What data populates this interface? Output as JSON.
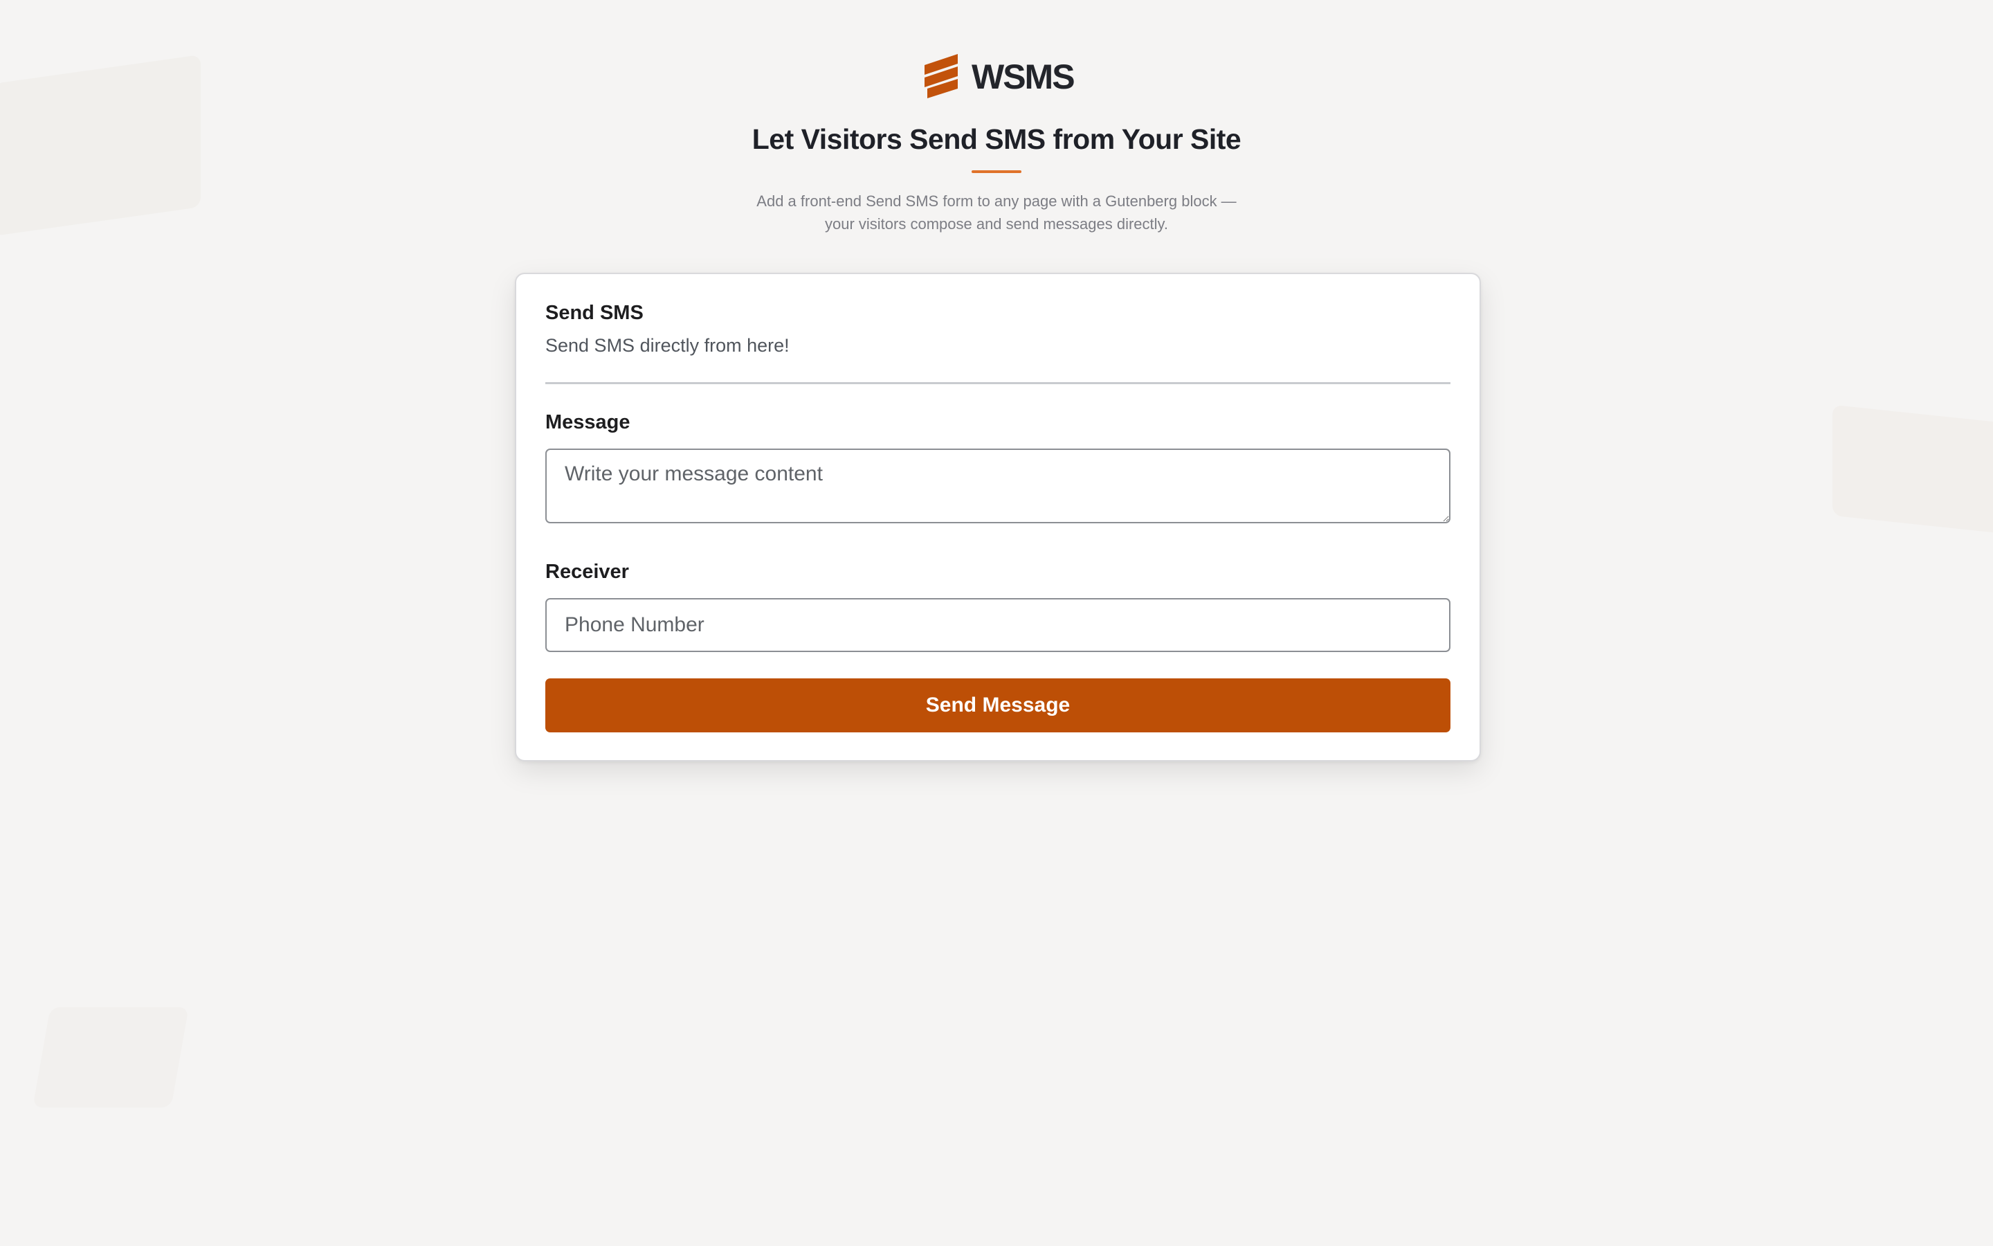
{
  "brand": {
    "name": "WSMS",
    "logo_icon": "wsms-stripes-logo-icon",
    "accent_color": "#bd4f06"
  },
  "header": {
    "title": "Let Visitors Send SMS from Your Site",
    "subtitle_line1": "Add a front-end Send SMS form to any page with a Gutenberg block —",
    "subtitle_line2": "your visitors compose and send messages directly.",
    "underline_color": "#e0722a"
  },
  "form": {
    "title": "Send SMS",
    "description": "Send SMS directly from here!",
    "message_label": "Message",
    "message_placeholder": "Write your message content",
    "message_value": "",
    "receiver_label": "Receiver",
    "receiver_placeholder": "Phone Number",
    "receiver_value": "",
    "submit_label": "Send Message",
    "submit_color": "#bd4f06"
  }
}
